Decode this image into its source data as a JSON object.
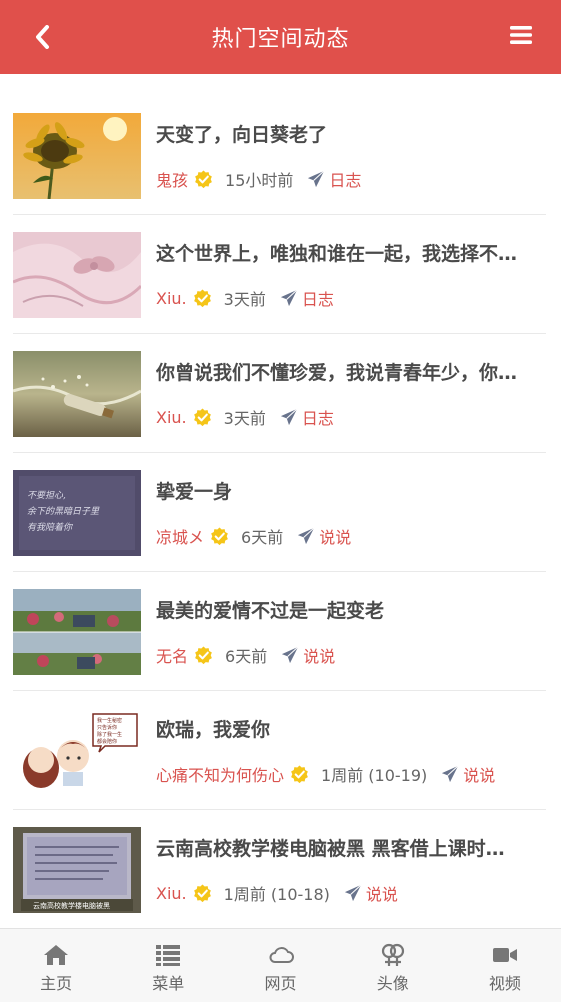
{
  "header": {
    "title": "热门空间动态"
  },
  "posts": [
    {
      "title": "天变了，向日葵老了",
      "author": "鬼孩",
      "time": "15小时前",
      "category": "日志"
    },
    {
      "title": "这个世界上，唯独和谁在一起，我选择不…",
      "author": "Xiu.",
      "time": "3天前",
      "category": "日志"
    },
    {
      "title": "你曾说我们不懂珍爱，我说青春年少，你…",
      "author": "Xiu.",
      "time": "3天前",
      "category": "日志"
    },
    {
      "title": "挚爱一身",
      "author": "凉城メ",
      "time": "6天前",
      "category": "说说"
    },
    {
      "title": "最美的爱情不过是一起变老",
      "author": "无名",
      "time": "6天前",
      "category": "说说"
    },
    {
      "title": "欧瑞，我爱你",
      "author": "心痛不知为何伤心",
      "time": "1周前 (10-19)",
      "category": "说说"
    },
    {
      "title": "云南高校教学楼电脑被黑 黑客借上课时…",
      "author": "Xiu.",
      "time": "1周前 (10-18)",
      "category": "说说"
    }
  ],
  "thumb_text": {
    "p4": [
      "不要担心,",
      "余下的黑暗日子里",
      "有我陪着你"
    ],
    "p6_bubble": [
      "我一生秘密",
      "只告诉你",
      "除了我一生",
      "都会陪你"
    ],
    "p7_caption": "云南高校教学楼电脑被黑"
  },
  "tabs": [
    {
      "label": "主页",
      "icon": "home-icon"
    },
    {
      "label": "菜单",
      "icon": "list-icon"
    },
    {
      "label": "网页",
      "icon": "cloud-icon"
    },
    {
      "label": "头像",
      "icon": "gender-icon"
    },
    {
      "label": "视频",
      "icon": "video-camera-icon"
    }
  ],
  "colors": {
    "header": "#e0504b",
    "author": "#d9534f",
    "verified": "#f5c518"
  }
}
